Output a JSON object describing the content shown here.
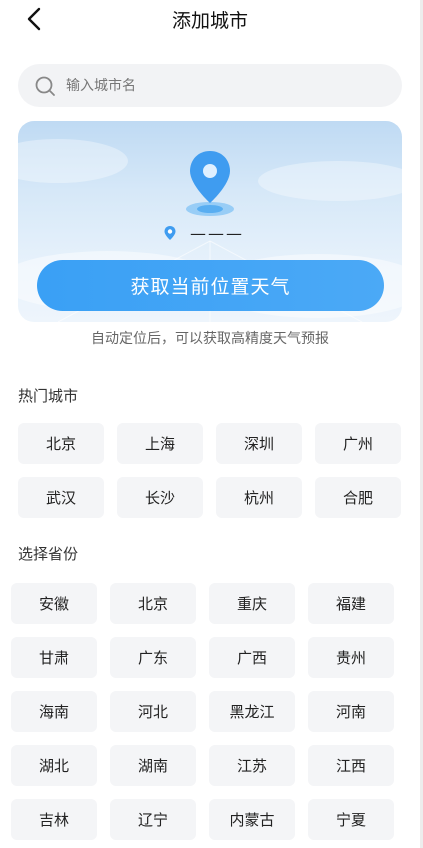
{
  "header": {
    "title": "添加城市"
  },
  "search": {
    "placeholder": "输入城市名"
  },
  "locate_card": {
    "location_text": "———",
    "button_label": "获取当前位置天气"
  },
  "hint": "自动定位后，可以获取高精度天气预报",
  "hot_cities": {
    "title": "热门城市",
    "items": [
      "北京",
      "上海",
      "深圳",
      "广州",
      "武汉",
      "长沙",
      "杭州",
      "合肥"
    ]
  },
  "provinces": {
    "title": "选择省份",
    "items": [
      "安徽",
      "北京",
      "重庆",
      "福建",
      "甘肃",
      "广东",
      "广西",
      "贵州",
      "海南",
      "河北",
      "黑龙江",
      "河南",
      "湖北",
      "湖南",
      "江苏",
      "江西",
      "吉林",
      "辽宁",
      "内蒙古",
      "宁夏"
    ]
  },
  "colors": {
    "accent": "#3aa0f5",
    "chip_bg": "#f4f5f7",
    "search_bg": "#f2f3f5"
  },
  "icons": {
    "back": "chevron-left-icon",
    "search": "search-icon",
    "pin": "location-pin-icon",
    "dot": "location-dot-icon"
  }
}
